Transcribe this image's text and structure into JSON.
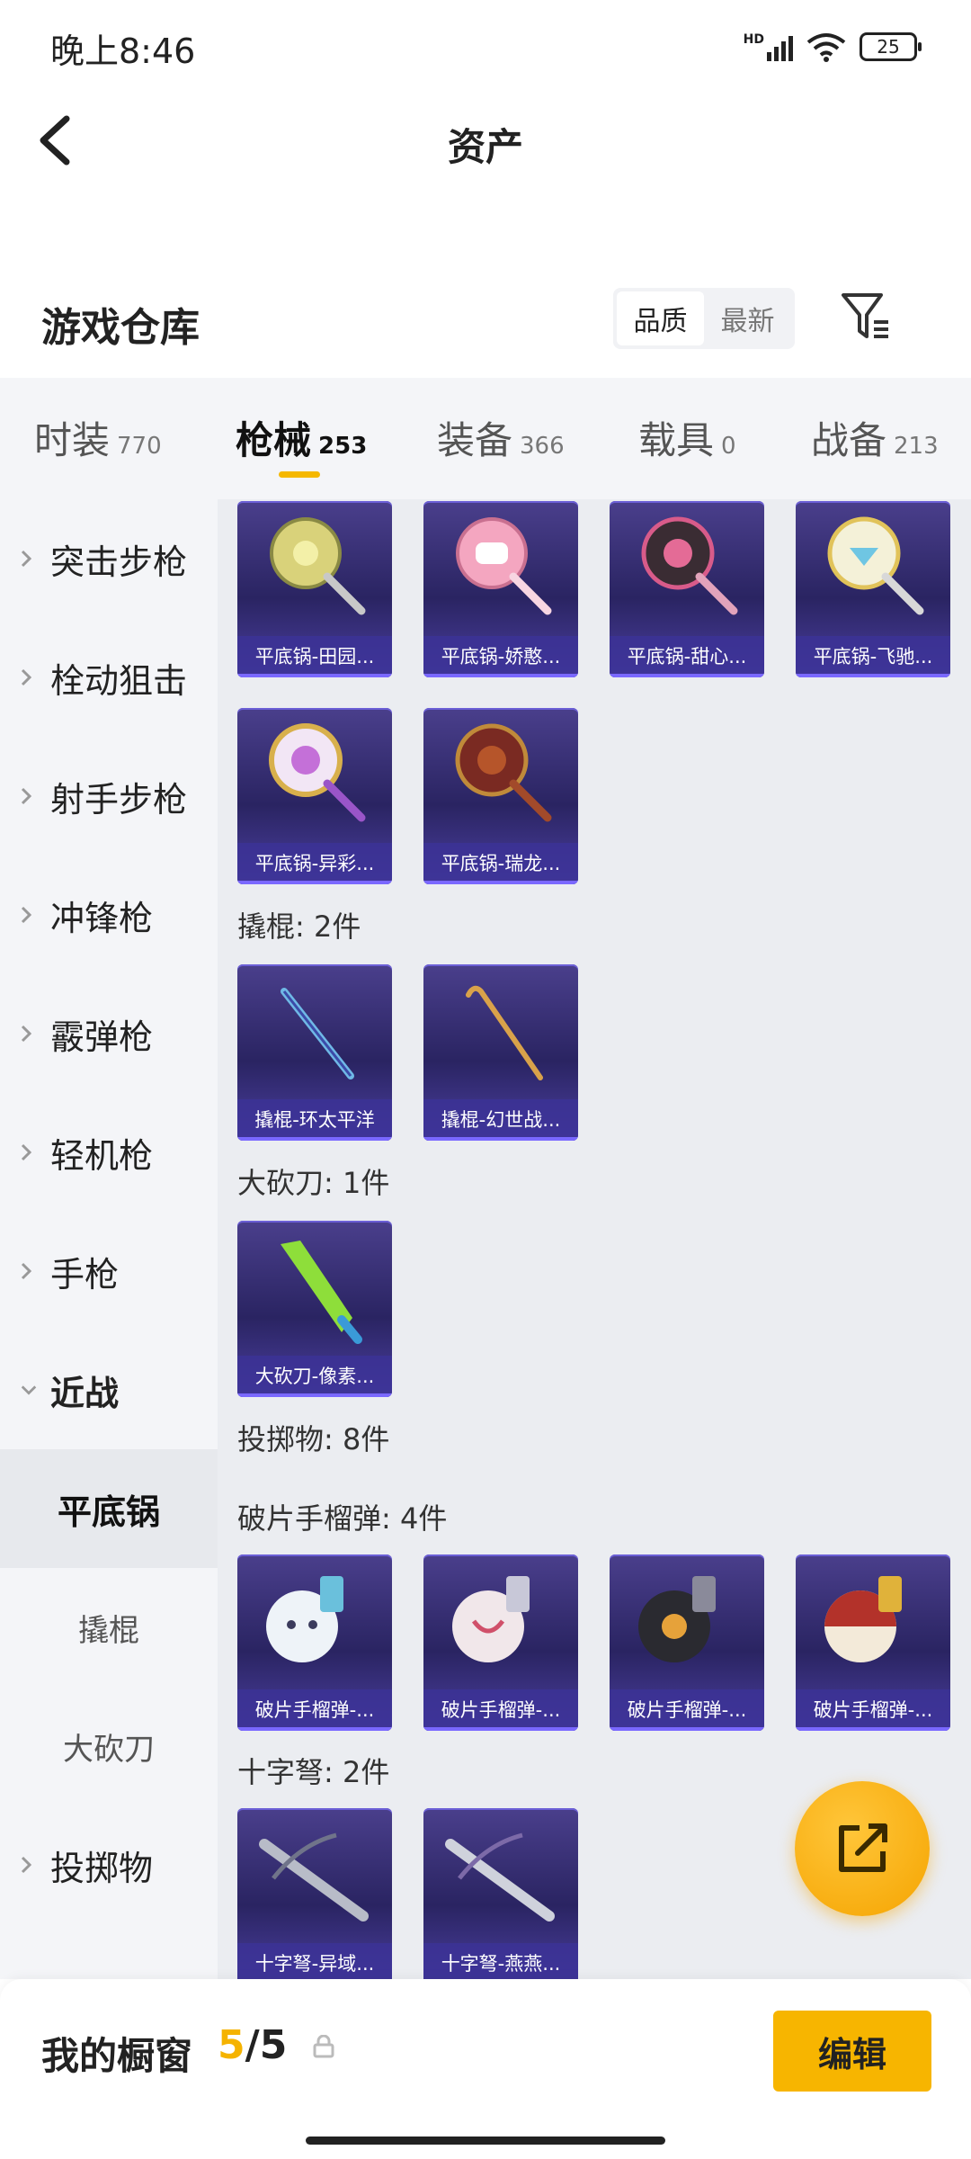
{
  "status_bar": {
    "time": "晚上8:46",
    "network": "HD",
    "battery": "25"
  },
  "header": {
    "title": "资产"
  },
  "warehouse": {
    "title": "游戏仓库",
    "sort_options": [
      {
        "label": "品质",
        "active": true
      },
      {
        "label": "最新",
        "active": false
      }
    ]
  },
  "tabs": [
    {
      "label": "时装",
      "count": "770",
      "active": false
    },
    {
      "label": "枪械",
      "count": "253",
      "active": true
    },
    {
      "label": "装备",
      "count": "366",
      "active": false
    },
    {
      "label": "载具",
      "count": "0",
      "active": false
    },
    {
      "label": "战备",
      "count": "213",
      "active": false
    }
  ],
  "sidebar": {
    "categories": [
      {
        "label": "突击步枪",
        "expanded": false
      },
      {
        "label": "栓动狙击",
        "expanded": false
      },
      {
        "label": "射手步枪",
        "expanded": false
      },
      {
        "label": "冲锋枪",
        "expanded": false
      },
      {
        "label": "霰弹枪",
        "expanded": false
      },
      {
        "label": "轻机枪",
        "expanded": false
      },
      {
        "label": "手枪",
        "expanded": false
      },
      {
        "label": "近战",
        "expanded": true
      },
      {
        "label": "投掷物",
        "expanded": false
      }
    ],
    "subcategories": [
      {
        "label": "平底锅",
        "active": true
      },
      {
        "label": "撬棍",
        "active": false
      },
      {
        "label": "大砍刀",
        "active": false
      }
    ]
  },
  "content": {
    "pan_items": [
      "平底锅-田园...",
      "平底锅-娇憨...",
      "平底锅-甜心...",
      "平底锅-飞驰...",
      "平底锅-异彩...",
      "平底锅-瑞龙..."
    ],
    "crowbar_section": "撬棍: 2件",
    "crowbar_items": [
      "撬棍-环太平洋",
      "撬棍-幻世战..."
    ],
    "machete_section": "大砍刀: 1件",
    "machete_items": [
      "大砍刀-像素..."
    ],
    "throwable_section": "投掷物: 8件",
    "frag_section": "破片手榴弹: 4件",
    "frag_items": [
      "破片手榴弹-...",
      "破片手榴弹-...",
      "破片手榴弹-...",
      "破片手榴弹-..."
    ],
    "crossbow_section": "十字弩: 2件",
    "crossbow_items": [
      "十字弩-异域...",
      "十字弩-燕燕..."
    ]
  },
  "showcase": {
    "label": "我的橱窗",
    "current": "5",
    "total": "/5",
    "edit_label": "编辑"
  },
  "colors": {
    "accent": "#f7b500",
    "card_bg": "#2a2462",
    "card_caption": "#3c3296"
  }
}
